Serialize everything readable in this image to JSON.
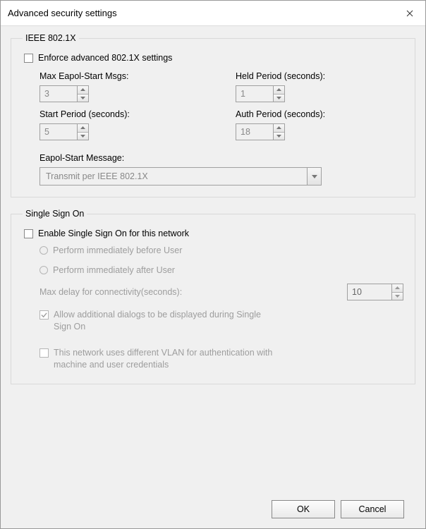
{
  "window": {
    "title": "Advanced security settings"
  },
  "ieee": {
    "legend": "IEEE 802.1X",
    "enforce_label": "Enforce advanced 802.1X settings",
    "enforce_checked": false,
    "max_eapol_label": "Max Eapol-Start Msgs:",
    "max_eapol_value": "3",
    "held_label": "Held Period (seconds):",
    "held_value": "1",
    "start_label": "Start Period (seconds):",
    "start_value": "5",
    "auth_label": "Auth Period (seconds):",
    "auth_value": "18",
    "eapol_msg_label": "Eapol-Start Message:",
    "eapol_msg_value": "Transmit per IEEE 802.1X"
  },
  "sso": {
    "legend": "Single Sign On",
    "enable_label": "Enable Single Sign On for this network",
    "enable_checked": false,
    "before_label": "Perform immediately before User",
    "after_label": "Perform immediately after User",
    "maxdelay_label": "Max delay for connectivity(seconds):",
    "maxdelay_value": "10",
    "allow_dialogs_label": "Allow additional dialogs to be displayed during Single Sign On",
    "allow_dialogs_checked": true,
    "diff_vlan_label": "This network uses different VLAN for authentication with machine and user credentials",
    "diff_vlan_checked": false
  },
  "buttons": {
    "ok": "OK",
    "cancel": "Cancel"
  }
}
